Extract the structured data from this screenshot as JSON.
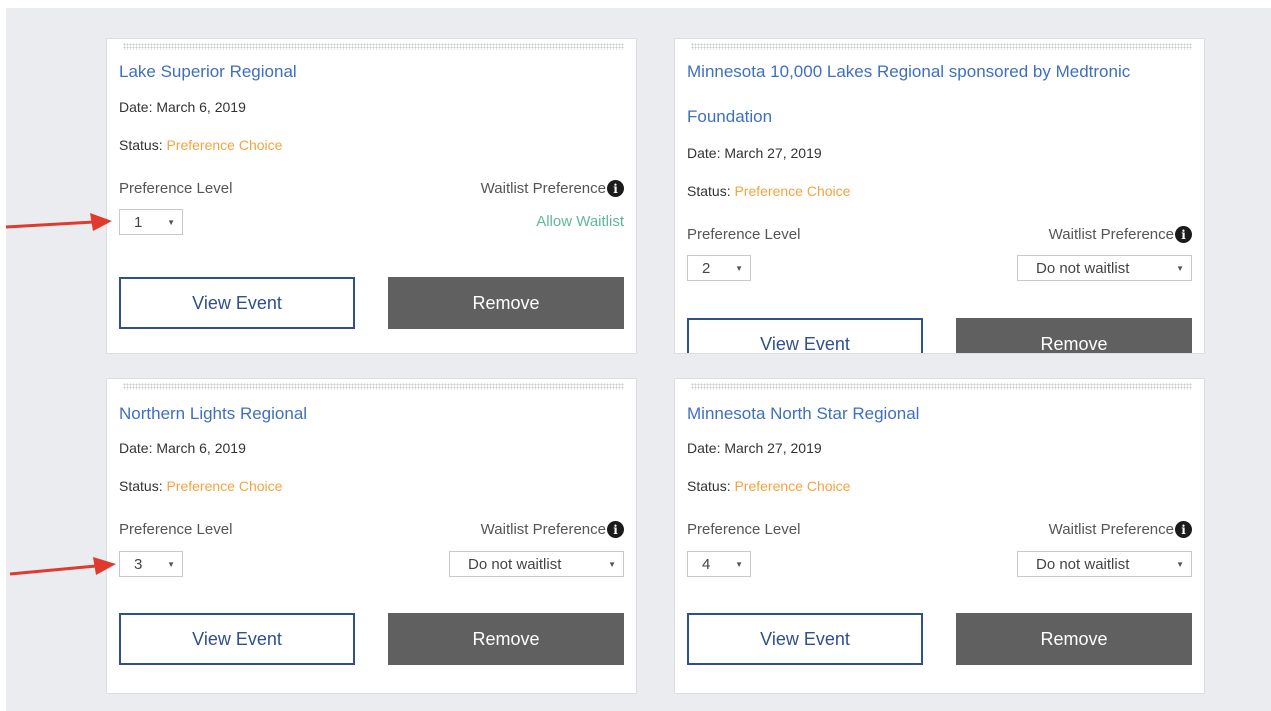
{
  "labels": {
    "date_prefix": "Date: ",
    "status_prefix": "Status: ",
    "preference_level": "Preference Level",
    "waitlist_preference": "Waitlist Preference",
    "info_icon": "i",
    "view_event": "View Event",
    "remove": "Remove"
  },
  "colors": {
    "title": "#3e6fc2",
    "status": "#f5a340",
    "allow_waitlist": "#5fb89a",
    "arrow": "#e03a2f",
    "remove_button": "#606060"
  },
  "cards": [
    {
      "title": "Lake Superior Regional",
      "date": "March 6, 2019",
      "status": "Preference Choice",
      "preference_level": "1",
      "waitlist": "Allow Waitlist"
    },
    {
      "title": "Minnesota 10,000 Lakes Regional sponsored by Medtronic Foundation",
      "date": "March 27, 2019",
      "status": "Preference Choice",
      "preference_level": "2",
      "waitlist": "Do not waitlist"
    },
    {
      "title": "Northern Lights Regional",
      "date": "March 6, 2019",
      "status": "Preference Choice",
      "preference_level": "3",
      "waitlist": "Do not waitlist"
    },
    {
      "title": "Minnesota North Star Regional",
      "date": "March 27, 2019",
      "status": "Preference Choice",
      "preference_level": "4",
      "waitlist": "Do not waitlist"
    }
  ]
}
